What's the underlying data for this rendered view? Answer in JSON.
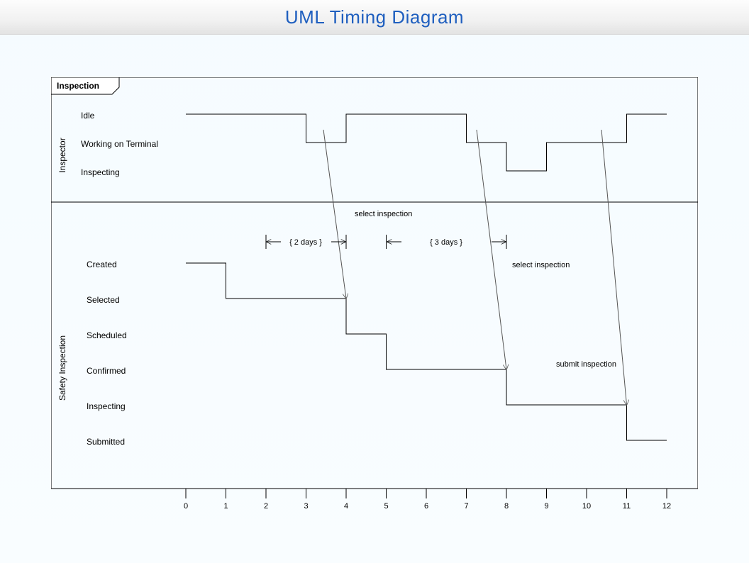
{
  "title": "UML Timing Diagram",
  "frame_name": "Inspection",
  "lifelines": {
    "inspector": {
      "name": "Inspector",
      "states": [
        "Idle",
        "Working on Terminal",
        "Inspecting"
      ],
      "timeline": [
        {
          "t": 0,
          "state": "Idle"
        },
        {
          "t": 3,
          "state": "Working on Terminal"
        },
        {
          "t": 4,
          "state": "Idle"
        },
        {
          "t": 7,
          "state": "Working on Terminal"
        },
        {
          "t": 8,
          "state": "Inspecting"
        },
        {
          "t": 9,
          "state": "Working on Terminal"
        },
        {
          "t": 11,
          "state": "Idle"
        }
      ]
    },
    "safety": {
      "name": "Safety Inspection",
      "states": [
        "Created",
        "Selected",
        "Scheduled",
        "Confirmed",
        "Inspecting",
        "Submitted"
      ],
      "timeline": [
        {
          "t": 0,
          "state": "Created"
        },
        {
          "t": 1,
          "state": "Selected"
        },
        {
          "t": 4,
          "state": "Scheduled"
        },
        {
          "t": 5,
          "state": "Confirmed"
        },
        {
          "t": 8,
          "state": "Inspecting"
        },
        {
          "t": 11,
          "state": "Submitted"
        }
      ]
    }
  },
  "messages": [
    {
      "label": "select inspection",
      "from_t": 4,
      "to_t": 4
    },
    {
      "label": "select inspection",
      "from_t": 7,
      "to_t": 8
    },
    {
      "label": "submit inspection",
      "from_t": 11,
      "to_t": 11
    }
  ],
  "constraints": [
    {
      "label": "{ 2 days }",
      "from_t": 2,
      "to_t": 4
    },
    {
      "label": "{ 3 days }",
      "from_t": 5,
      "to_t": 8
    }
  ],
  "axis": {
    "ticks": [
      0,
      1,
      2,
      3,
      4,
      5,
      6,
      7,
      8,
      9,
      10,
      11,
      12
    ]
  }
}
